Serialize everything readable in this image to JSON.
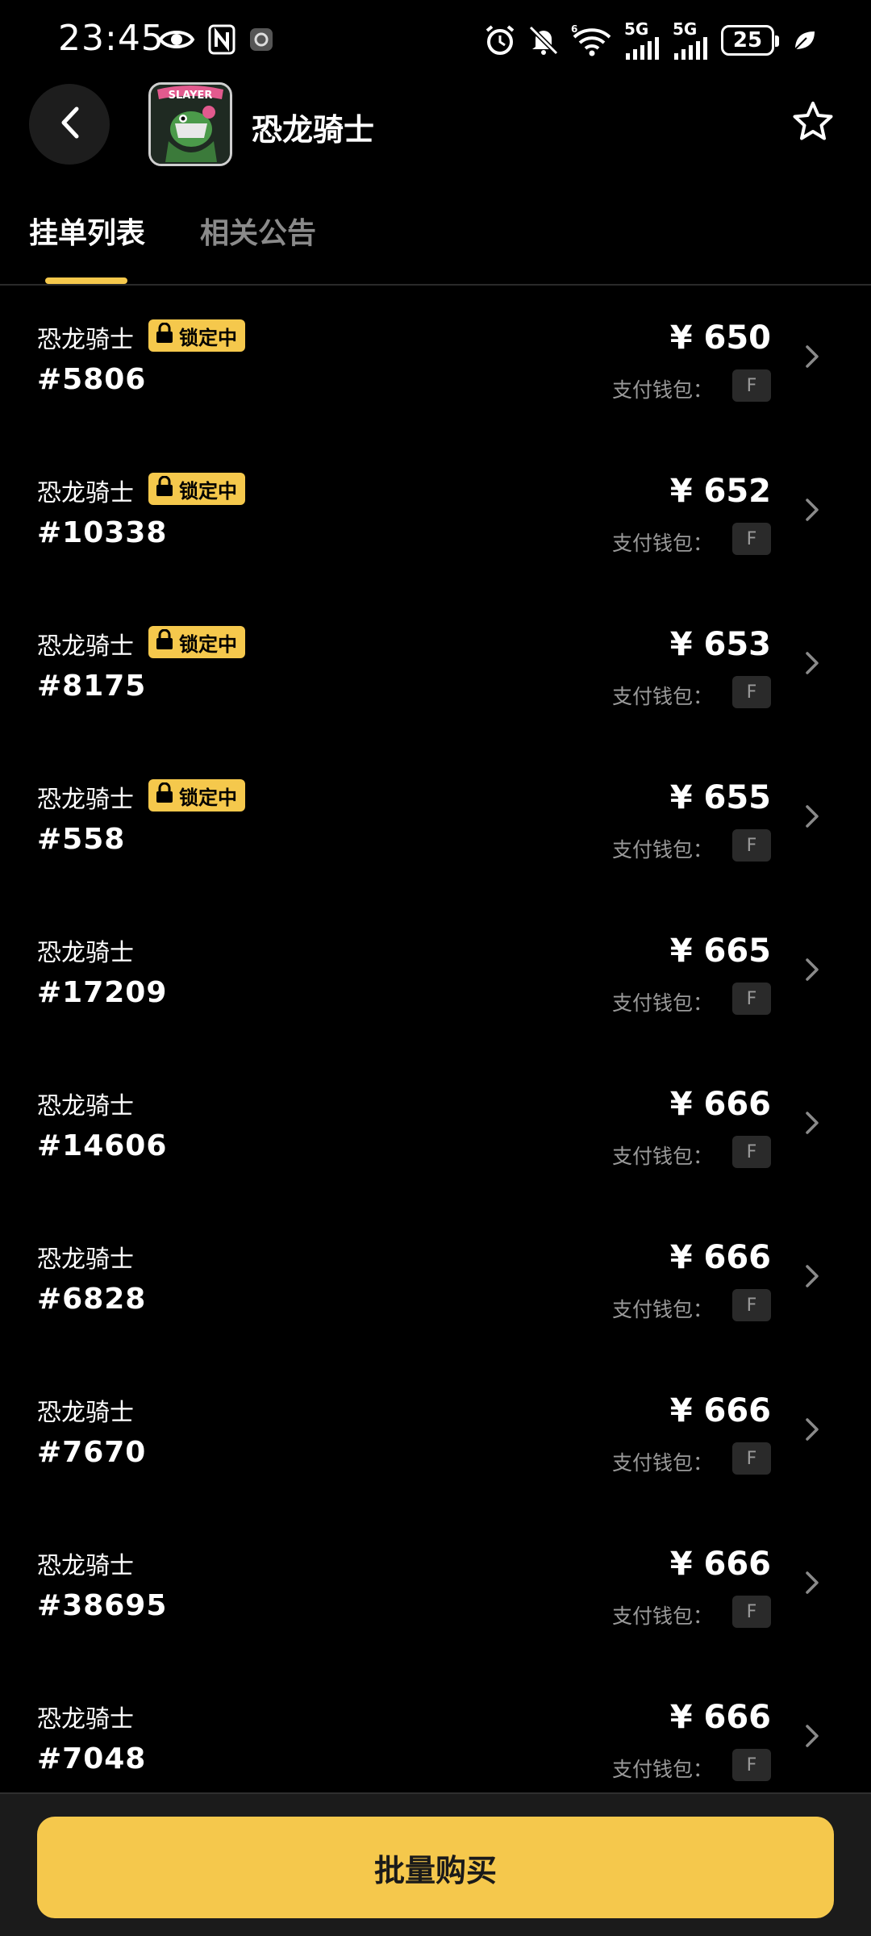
{
  "status_bar": {
    "time": "23:45",
    "battery": "25",
    "network1": "5G",
    "network2": "5G",
    "wifi_label": "6",
    "icons": [
      "eye-icon",
      "nfc-icon",
      "app-icon",
      "alarm-icon",
      "mute-icon",
      "wifi-icon",
      "signal-icon",
      "signal-icon",
      "battery-icon",
      "leaf-icon"
    ]
  },
  "header": {
    "title": "恐龙骑士",
    "back_icon": "chevron-left-icon",
    "favorite_icon": "star-outline-icon",
    "avatar_text": "SLAYER"
  },
  "tabs": [
    {
      "label": "挂单列表",
      "active": true
    },
    {
      "label": "相关公告",
      "active": false
    }
  ],
  "listings": [
    {
      "name": "恐龙骑士",
      "id": "#5806",
      "locked": true,
      "lock_label": "锁定中",
      "price": "¥ 650",
      "wallet_label": "支付钱包：",
      "wallet": "F"
    },
    {
      "name": "恐龙骑士",
      "id": "#10338",
      "locked": true,
      "lock_label": "锁定中",
      "price": "¥ 652",
      "wallet_label": "支付钱包：",
      "wallet": "F"
    },
    {
      "name": "恐龙骑士",
      "id": "#8175",
      "locked": true,
      "lock_label": "锁定中",
      "price": "¥ 653",
      "wallet_label": "支付钱包：",
      "wallet": "F"
    },
    {
      "name": "恐龙骑士",
      "id": "#558",
      "locked": true,
      "lock_label": "锁定中",
      "price": "¥ 655",
      "wallet_label": "支付钱包：",
      "wallet": "F"
    },
    {
      "name": "恐龙骑士",
      "id": "#17209",
      "locked": false,
      "lock_label": "",
      "price": "¥ 665",
      "wallet_label": "支付钱包：",
      "wallet": "F"
    },
    {
      "name": "恐龙骑士",
      "id": "#14606",
      "locked": false,
      "lock_label": "",
      "price": "¥ 666",
      "wallet_label": "支付钱包：",
      "wallet": "F"
    },
    {
      "name": "恐龙骑士",
      "id": "#6828",
      "locked": false,
      "lock_label": "",
      "price": "¥ 666",
      "wallet_label": "支付钱包：",
      "wallet": "F"
    },
    {
      "name": "恐龙骑士",
      "id": "#7670",
      "locked": false,
      "lock_label": "",
      "price": "¥ 666",
      "wallet_label": "支付钱包：",
      "wallet": "F"
    },
    {
      "name": "恐龙骑士",
      "id": "#38695",
      "locked": false,
      "lock_label": "",
      "price": "¥ 666",
      "wallet_label": "支付钱包：",
      "wallet": "F"
    },
    {
      "name": "恐龙骑士",
      "id": "#7048",
      "locked": false,
      "lock_label": "",
      "price": "¥ 666",
      "wallet_label": "支付钱包：",
      "wallet": "F"
    }
  ],
  "bottom": {
    "bulk_buy_label": "批量购买"
  },
  "colors": {
    "accent": "#f5c84c",
    "background": "#000000",
    "muted_text": "#9a9a9a"
  }
}
